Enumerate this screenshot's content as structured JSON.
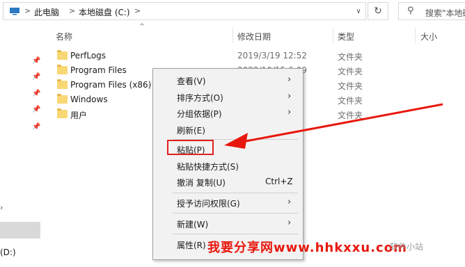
{
  "address_bar": {
    "crumbs": [
      "此电脑",
      "本地磁盘 (C:)"
    ],
    "separator": ">",
    "dropdown_glyph": "∨",
    "refresh_glyph": "↻"
  },
  "search": {
    "placeholder": "搜索\"本地磁盘\""
  },
  "nav": {
    "drive_label": "(D:)",
    "arrow_glyph": "›"
  },
  "columns": {
    "name": "名称",
    "modified": "修改日期",
    "type": "类型",
    "size": "大小",
    "sort_glyph": "^"
  },
  "files": [
    {
      "name": "PerfLogs",
      "date": "2019/3/19 12:52",
      "type": "文件夹"
    },
    {
      "name": "Program Files",
      "date": "2022/10/15 6:09",
      "type": "文件夹"
    },
    {
      "name": "Program Files (x86)",
      "date": "",
      "type": "文件夹"
    },
    {
      "name": "Windows",
      "date": "",
      "type": "文件夹"
    },
    {
      "name": "用户",
      "date": "",
      "type": "文件夹"
    }
  ],
  "context_menu": {
    "items": [
      {
        "label": "查看(V)",
        "submenu": true
      },
      {
        "label": "排序方式(O)",
        "submenu": true
      },
      {
        "label": "分组依据(P)",
        "submenu": true
      },
      {
        "label": "刷新(E)",
        "submenu": false
      },
      {
        "label": "粘贴(P)",
        "submenu": false,
        "highlighted": true
      },
      {
        "label": "粘贴快捷方式(S)",
        "submenu": false
      },
      {
        "label": "撤消 复制(U)",
        "submenu": false,
        "shortcut": "Ctrl+Z"
      },
      {
        "label": "授予访问权限(G)",
        "submenu": true
      },
      {
        "label": "新建(W)",
        "submenu": true
      },
      {
        "label": "属性(R)",
        "submenu": false
      }
    ],
    "submenu_glyph": "›"
  },
  "watermark": {
    "text": "我要分享网www.hhkxxu.com",
    "gray_text": "软件小站"
  },
  "colors": {
    "annotation_red": "#e8170e",
    "folder_yellow": "#f8d775",
    "menu_bg": "#f2f2f2"
  },
  "icons": {
    "pin": "pin-icon",
    "folder": "folder-icon",
    "search": "search-icon",
    "pc": "this-pc-icon"
  }
}
